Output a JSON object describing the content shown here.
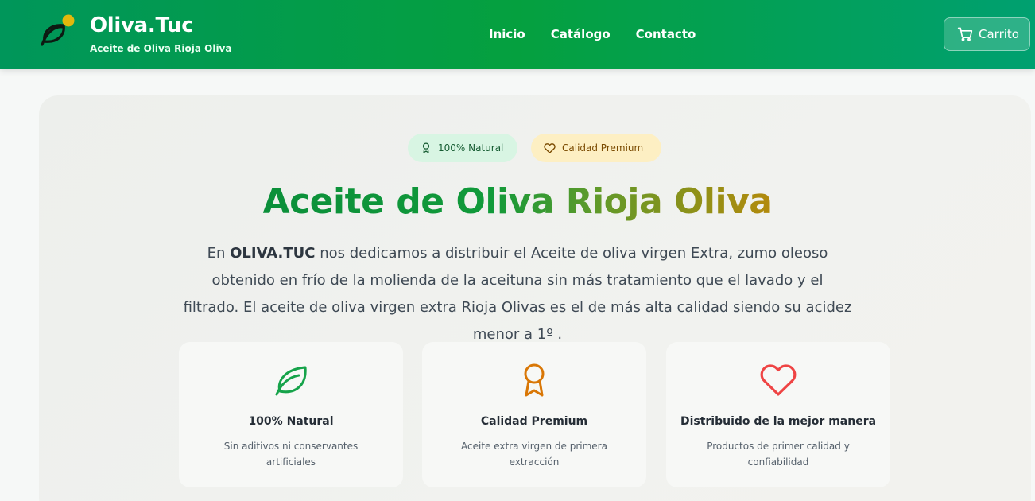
{
  "header": {
    "brand_title": "Oliva.Tuc",
    "brand_subtitle": "Aceite de Oliva Rioja Oliva",
    "nav": [
      "Inicio",
      "Catálogo",
      "Contacto"
    ],
    "cart_label": "Carrito",
    "colors": {
      "header_start": "#00965a",
      "header_end": "#00a070"
    }
  },
  "hero": {
    "badges": [
      {
        "label": "100% Natural",
        "icon": "award-icon"
      },
      {
        "label": "Calidad Premium",
        "icon": "heart-icon"
      }
    ],
    "title": "Aceite de Oliva Rioja Oliva",
    "desc_brand": "OLIVA.TUC",
    "desc_prefix": "En ",
    "desc_rest": " nos dedicamos a distribuir el Aceite de oliva virgen Extra, zumo oleoso obtenido en frío de la molienda de la aceituna sin más tratamiento que el lavado y el filtrado. El aceite de oliva virgen extra Rioja Olivas es el de más alta calidad siendo su acidez menor a 1º ."
  },
  "features": [
    {
      "icon": "leaf-icon",
      "title": "100% Natural",
      "desc": "Sin aditivos ni conservantes artificiales",
      "color": "#16a34a"
    },
    {
      "icon": "award-icon",
      "title": "Calidad Premium",
      "desc": "Aceite extra virgen de primera extracción",
      "color": "#d97706"
    },
    {
      "icon": "heart-icon",
      "title": "Distribuido de la mejor manera",
      "desc": "Productos de primer calidad y confiabilidad",
      "color": "#ef4444"
    }
  ]
}
